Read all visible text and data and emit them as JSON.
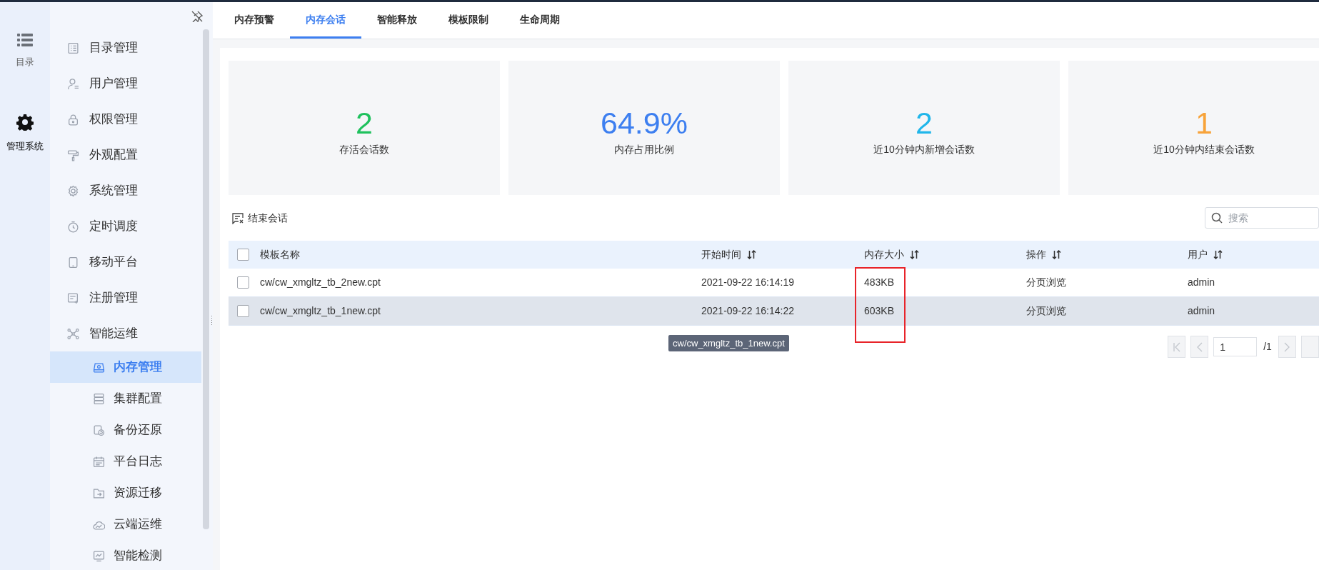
{
  "rail": [
    {
      "label": "目录",
      "selected": false
    },
    {
      "label": "管理系统",
      "selected": true
    }
  ],
  "nav": {
    "items": [
      {
        "label": "目录管理",
        "selected": false
      },
      {
        "label": "用户管理",
        "selected": false
      },
      {
        "label": "权限管理",
        "selected": false
      },
      {
        "label": "外观配置",
        "selected": false
      },
      {
        "label": "系统管理",
        "selected": false
      },
      {
        "label": "定时调度",
        "selected": false
      },
      {
        "label": "移动平台",
        "selected": false
      },
      {
        "label": "注册管理",
        "selected": false
      },
      {
        "label": "智能运维",
        "selected": false,
        "children": [
          {
            "label": "内存管理",
            "selected": true
          },
          {
            "label": "集群配置",
            "selected": false
          },
          {
            "label": "备份还原",
            "selected": false
          },
          {
            "label": "平台日志",
            "selected": false
          },
          {
            "label": "资源迁移",
            "selected": false
          },
          {
            "label": "云端运维",
            "selected": false
          },
          {
            "label": "智能检测",
            "selected": false
          }
        ]
      }
    ]
  },
  "tabs": [
    {
      "label": "内存预警",
      "selected": false
    },
    {
      "label": "内存会话",
      "selected": true
    },
    {
      "label": "智能释放",
      "selected": false
    },
    {
      "label": "模板限制",
      "selected": false
    },
    {
      "label": "生命周期",
      "selected": false
    }
  ],
  "stats": [
    {
      "value": "2",
      "label": "存活会话数",
      "color": "#1fc15d"
    },
    {
      "value": "64.9%",
      "label": "内存占用比例",
      "color": "#3d7ff0"
    },
    {
      "value": "2",
      "label": "近10分钟内新增会话数",
      "color": "#20b6ea"
    },
    {
      "value": "1",
      "label": "近10分钟内结束会话数",
      "color": "#f7a33a"
    }
  ],
  "toolbar": {
    "end_session_button": "结束会话",
    "search": {
      "placeholder": "搜索"
    }
  },
  "table": {
    "select_all": {
      "checked": false
    },
    "columns": [
      {
        "label": "模板名称",
        "sortable": false
      },
      {
        "label": "开始时间",
        "sortable": true
      },
      {
        "label": "内存大小",
        "sortable": true
      },
      {
        "label": "操作",
        "sortable": true
      },
      {
        "label": "用户",
        "sortable": true
      }
    ],
    "rows": [
      {
        "checked": false,
        "highlighted": false,
        "cells": [
          "cw/cw_xmgltz_tb_2new.cpt",
          "2021-09-22 16:14:19",
          "483KB",
          "分页浏览",
          "admin"
        ]
      },
      {
        "checked": false,
        "highlighted": true,
        "cells": [
          "cw/cw_xmgltz_tb_1new.cpt",
          "2021-09-22 16:14:22",
          "603KB",
          "分页浏览",
          "admin"
        ]
      }
    ]
  },
  "tooltip": "cw/cw_xmgltz_tb_1new.cpt",
  "pagination": {
    "page": "1",
    "total": "/1"
  }
}
